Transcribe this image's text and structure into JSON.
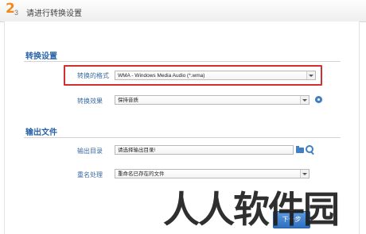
{
  "header": {
    "step_current": "2",
    "step_total": "3",
    "title": "请进行转换设置"
  },
  "conversion_settings": {
    "section_title": "转换设置",
    "format_label": "转换的格式",
    "format_value": "WMA - Windows Media Audio (*.wma)",
    "effect_label": "转换效果",
    "effect_value": "保持音质"
  },
  "output_file": {
    "section_title": "输出文件",
    "dir_label": "输出目录",
    "dir_value": "请选择输出目录!",
    "duplicate_label": "重名处理",
    "duplicate_value": "重命名已存在的文件"
  },
  "footer": {
    "next_label": "下一步"
  },
  "watermark": "人人软件园",
  "colors": {
    "accent": "#2a64a8",
    "highlight": "#d23030",
    "step": "#f08a1c"
  }
}
